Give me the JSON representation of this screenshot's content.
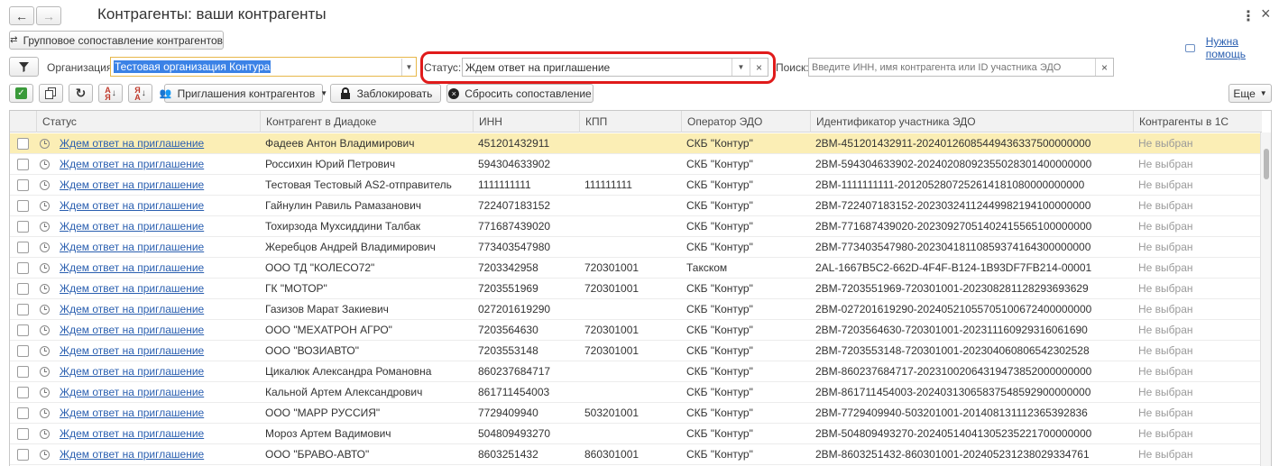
{
  "window": {
    "title": "Контрагенты: ваши контрагенты",
    "menu_icon": "⋮",
    "close_icon": "×",
    "back_icon": "←",
    "forward_icon": "→"
  },
  "toolbar_top": {
    "group_match_label": "Групповое сопоставление контрагентов",
    "help_link": "Нужна помощь"
  },
  "filters": {
    "org_label": "Организация:",
    "org_value": "Тестовая организация Контура",
    "status_label": "Статус:",
    "status_value": "Ждем ответ на приглашение",
    "search_label": "Поиск:",
    "search_placeholder": "Введите ИНН, имя контрагента или ID участника ЭДО"
  },
  "toolbar": {
    "invitations_label": "Приглашения контрагентов",
    "block_label": "Заблокировать",
    "reset_label": "Сбросить сопоставление",
    "more_label": "Еще"
  },
  "table": {
    "columns": [
      "Статус",
      "Контрагент в Диадоке",
      "ИНН",
      "КПП",
      "Оператор ЭДО",
      "Идентификатор участника ЭДО",
      "Контрагенты в 1С"
    ],
    "rows": [
      {
        "status": "Ждем ответ на приглашение",
        "name": "Фадеев Антон Владимирович",
        "inn": "451201432911",
        "kpp": "",
        "operator": "СКБ \"Контур\"",
        "edo_id": "2BM-451201432911-20240126085449436337500000000",
        "c1": "Не выбран"
      },
      {
        "status": "Ждем ответ на приглашение",
        "name": "Россихин Юрий Петрович",
        "inn": "594304633902",
        "kpp": "",
        "operator": "СКБ \"Контур\"",
        "edo_id": "2BM-594304633902-20240208092355028301400000000",
        "c1": "Не выбран"
      },
      {
        "status": "Ждем ответ на приглашение",
        "name": "Тестовая Тестовый AS2-отправитель",
        "inn": "1111111111",
        "kpp": "111111111",
        "operator": "СКБ \"Контур\"",
        "edo_id": "2BM-1111111111-2012052807252614181080000000000",
        "c1": "Не выбран"
      },
      {
        "status": "Ждем ответ на приглашение",
        "name": "Гайнулин Равиль Рамазанович",
        "inn": "722407183152",
        "kpp": "",
        "operator": "СКБ \"Контур\"",
        "edo_id": "2BM-722407183152-20230324112449982194100000000",
        "c1": "Не выбран"
      },
      {
        "status": "Ждем ответ на приглашение",
        "name": "Тохирзода Мухсиддини Талбак",
        "inn": "771687439020",
        "kpp": "",
        "operator": "СКБ \"Контур\"",
        "edo_id": "2BM-771687439020-20230927051402415565100000000",
        "c1": "Не выбран"
      },
      {
        "status": "Ждем ответ на приглашение",
        "name": "Жеребцов Андрей Владимирович",
        "inn": "773403547980",
        "kpp": "",
        "operator": "СКБ \"Контур\"",
        "edo_id": "2BM-773403547980-20230418110859374164300000000",
        "c1": "Не выбран"
      },
      {
        "status": "Ждем ответ на приглашение",
        "name": "ООО ТД \"КОЛЕСО72\"",
        "inn": "7203342958",
        "kpp": "720301001",
        "operator": "Такском",
        "edo_id": "2AL-1667B5C2-662D-4F4F-B124-1B93DF7FB214-00001",
        "c1": "Не выбран"
      },
      {
        "status": "Ждем ответ на приглашение",
        "name": "ГК \"МОТОР\"",
        "inn": "7203551969",
        "kpp": "720301001",
        "operator": "СКБ \"Контур\"",
        "edo_id": "2BM-7203551969-720301001-202308281128293693629",
        "c1": "Не выбран"
      },
      {
        "status": "Ждем ответ на приглашение",
        "name": "Газизов Марат Закиевич",
        "inn": "027201619290",
        "kpp": "",
        "operator": "СКБ \"Контур\"",
        "edo_id": "2BM-027201619290-20240521055705100672400000000",
        "c1": "Не выбран"
      },
      {
        "status": "Ждем ответ на приглашение",
        "name": "ООО \"МЕХАТРОН АГРО\"",
        "inn": "7203564630",
        "kpp": "720301001",
        "operator": "СКБ \"Контур\"",
        "edo_id": "2BM-7203564630-720301001-20231116092931606169​0",
        "c1": "Не выбран"
      },
      {
        "status": "Ждем ответ на приглашение",
        "name": "ООО \"ВОЗИАВТО\"",
        "inn": "7203553148",
        "kpp": "720301001",
        "operator": "СКБ \"Контур\"",
        "edo_id": "2BM-7203553148-720301001-20230406080654230252​8",
        "c1": "Не выбран"
      },
      {
        "status": "Ждем ответ на приглашение",
        "name": "Цикалюк Александра Романовна",
        "inn": "860237684717",
        "kpp": "",
        "operator": "СКБ \"Контур\"",
        "edo_id": "2BM-860237684717-20231002064319473852000000000",
        "c1": "Не выбран"
      },
      {
        "status": "Ждем ответ на приглашение",
        "name": "Кальной Артем Александрович",
        "inn": "861711454003",
        "kpp": "",
        "operator": "СКБ \"Контур\"",
        "edo_id": "2BM-861711454003-20240313065837548592900000000",
        "c1": "Не выбран"
      },
      {
        "status": "Ждем ответ на приглашение",
        "name": "ООО \"МАРР РУССИЯ\"",
        "inn": "7729409940",
        "kpp": "503201001",
        "operator": "СКБ \"Контур\"",
        "edo_id": "2BM-7729409940-503201001-20140813111236539283​6",
        "c1": "Не выбран"
      },
      {
        "status": "Ждем ответ на приглашение",
        "name": "Мороз Артем Вадимович",
        "inn": "504809493270",
        "kpp": "",
        "operator": "СКБ \"Контур\"",
        "edo_id": "2BM-504809493270-20240514041305235221700000000",
        "c1": "Не выбран"
      },
      {
        "status": "Ждем ответ на приглашение",
        "name": "ООО \"БРАВО-АВТО\"",
        "inn": "8603251432",
        "kpp": "860301001",
        "operator": "СКБ \"Контур\"",
        "edo_id": "2BM-8603251432-860301001-20240523123802933476​1",
        "c1": "Не выбран"
      }
    ]
  },
  "colors": {
    "highlight_ring": "#e01b1b",
    "selected_row": "#fbeeb5",
    "link": "#2a5fb0",
    "org_selection": "#3b82e6"
  }
}
